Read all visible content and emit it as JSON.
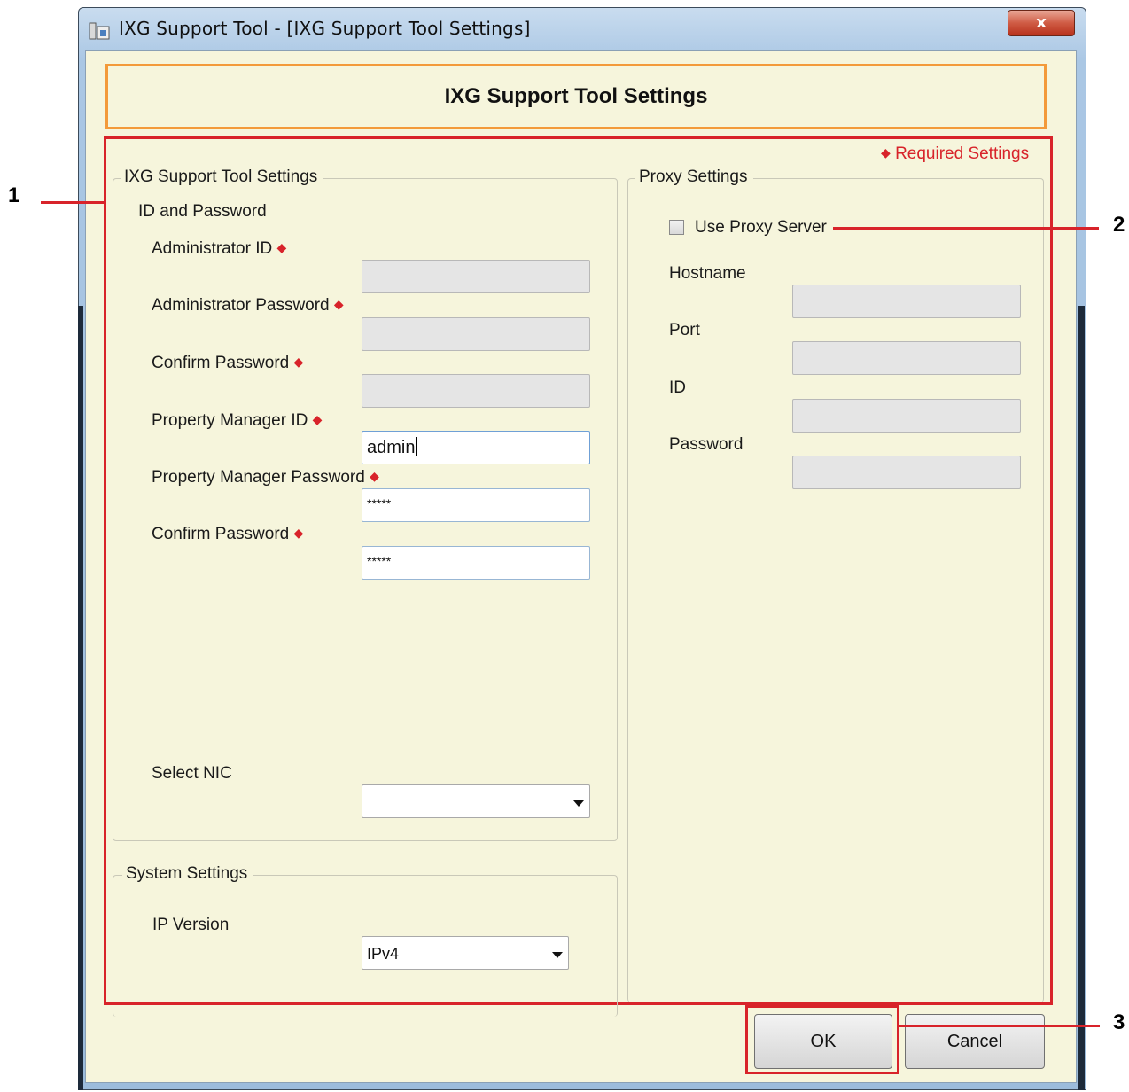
{
  "window": {
    "title": "IXG Support Tool - [IXG Support Tool Settings]",
    "close_label": "x"
  },
  "header": {
    "title": "IXG Support Tool Settings"
  },
  "required_note": {
    "marker": "◆",
    "text": "Required Settings"
  },
  "support_group": {
    "title": "IXG Support Tool Settings",
    "section_label": "ID and Password",
    "fields": [
      {
        "label": "Administrator ID",
        "required": true,
        "value": ""
      },
      {
        "label": "Administrator Password",
        "required": true,
        "value": ""
      },
      {
        "label": "Confirm Password",
        "required": true,
        "value": ""
      },
      {
        "label": "Property Manager ID",
        "required": true,
        "value": "admin"
      },
      {
        "label": "Property Manager Password",
        "required": true,
        "value": "*****"
      },
      {
        "label": "Confirm Password",
        "required": true,
        "value": "*****"
      }
    ],
    "nic_label": "Select NIC",
    "nic_value": ""
  },
  "system_group": {
    "title": "System Settings",
    "ip_label": "IP Version",
    "ip_value": "IPv4"
  },
  "proxy_group": {
    "title": "Proxy Settings",
    "use_proxy_label": "Use Proxy Server",
    "use_proxy_checked": false,
    "fields": [
      {
        "label": "Hostname",
        "value": ""
      },
      {
        "label": "Port",
        "value": ""
      },
      {
        "label": "ID",
        "value": ""
      },
      {
        "label": "Password",
        "value": ""
      }
    ]
  },
  "buttons": {
    "ok": "OK",
    "cancel": "Cancel"
  },
  "callouts": [
    "1",
    "2",
    "3"
  ],
  "colors": {
    "callout_red": "#d8232a",
    "header_border": "#f39a3a",
    "panel_bg": "#f6f5dc"
  }
}
